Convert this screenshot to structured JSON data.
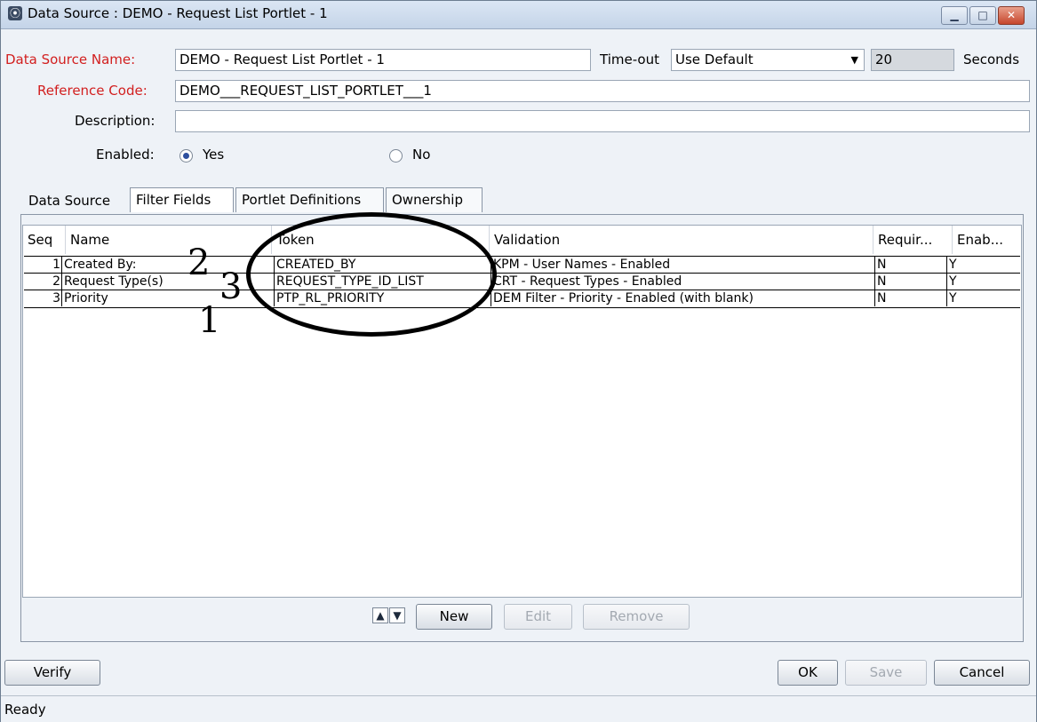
{
  "window": {
    "title": "Data Source : DEMO - Request List Portlet - 1",
    "minimize_glyph": "▁",
    "maximize_glyph": "□",
    "close_glyph": "✕"
  },
  "form": {
    "ds_name_label": "Data Source Name:",
    "ds_name_value": "DEMO - Request List Portlet - 1",
    "timeout_label": "Time-out",
    "timeout_value": "Use Default",
    "timeout_seconds": "20",
    "seconds_label": "Seconds",
    "ref_code_label": "Reference Code:",
    "ref_code_value": "DEMO___REQUEST_LIST_PORTLET___1",
    "description_label": "Description:",
    "description_value": "",
    "enabled_label": "Enabled:",
    "yes_label": "Yes",
    "no_label": "No",
    "enabled_selected": "Yes"
  },
  "tabs": [
    {
      "label": "Data Source"
    },
    {
      "label": "Filter Fields"
    },
    {
      "label": "Portlet Definitions"
    },
    {
      "label": "Ownership"
    }
  ],
  "table": {
    "headers": [
      "Seq",
      "Name",
      "Token",
      "Validation",
      "Requir...",
      "Enab..."
    ],
    "rows": [
      {
        "seq": "1",
        "name": "Created By:",
        "token": "CREATED_BY",
        "validation": "KPM - User Names - Enabled",
        "required": "N",
        "enabled": "Y"
      },
      {
        "seq": "2",
        "name": "Request Type(s)",
        "token": "REQUEST_TYPE_ID_LIST",
        "validation": "CRT - Request Types - Enabled",
        "required": "N",
        "enabled": "Y"
      },
      {
        "seq": "3",
        "name": "Priority",
        "token": "PTP_RL_PRIORITY",
        "validation": "DEM Filter - Priority - Enabled (with blank)",
        "required": "N",
        "enabled": "Y"
      }
    ]
  },
  "annotations": {
    "num_1": "1",
    "num_2": "2",
    "num_3": "3"
  },
  "table_buttons": {
    "up_glyph": "▲",
    "down_glyph": "▼",
    "new": "New",
    "edit": "Edit",
    "remove": "Remove"
  },
  "footer": {
    "verify": "Verify",
    "ok": "OK",
    "save": "Save",
    "cancel": "Cancel"
  },
  "status": {
    "text": "Ready"
  }
}
